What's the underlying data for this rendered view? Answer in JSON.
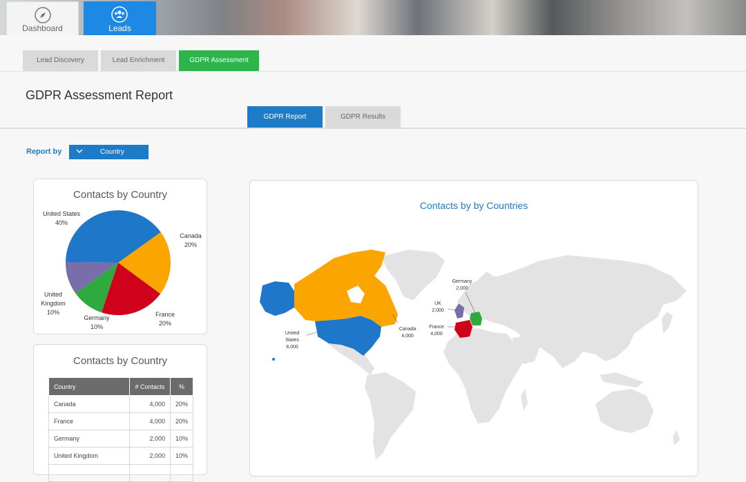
{
  "app_tabs": {
    "dashboard": "Dashboard",
    "leads": "Leads"
  },
  "sub_tabs": [
    "Lead Discovery",
    "Lead Enrichment",
    "GDPR Assessment"
  ],
  "page_title": "GDPR Assessment Report",
  "view_tabs": [
    "GDPR Report",
    "GDPR Results"
  ],
  "report_by": {
    "label": "Report by",
    "value": "Country"
  },
  "colors": {
    "us": "#1f77c9",
    "canada": "#fba500",
    "france": "#d0021b",
    "germany": "#2eaa3f",
    "uk": "#7a6eaa",
    "accent": "#1e7bc8",
    "active_tab": "#2bb54a"
  },
  "pie_card": {
    "title": "Contacts by Country"
  },
  "table_card": {
    "title": "Contacts by Country",
    "headers": [
      "Country",
      "# Contacts",
      "%"
    ],
    "rows": [
      [
        "Canada",
        "4,000",
        "20%"
      ],
      [
        "France",
        "4,000",
        "20%"
      ],
      [
        "Germany",
        "2,000",
        "10%"
      ],
      [
        "United Kingdom",
        "2,000",
        "10%"
      ]
    ]
  },
  "map_card": {
    "title": "Contacts by by Countries",
    "labels": {
      "us": [
        "United",
        "States",
        "8,000"
      ],
      "canada": [
        "Canada",
        "4,000"
      ],
      "germany": [
        "Germany",
        "2,000"
      ],
      "uk": [
        "UK",
        "2,000"
      ],
      "france": [
        "France",
        "4,000"
      ]
    }
  },
  "chart_data": {
    "type": "pie",
    "title": "Contacts by Country",
    "categories": [
      "United States",
      "Canada",
      "France",
      "Germany",
      "United Kingdom"
    ],
    "values": [
      40,
      20,
      20,
      10,
      10
    ],
    "labels": [
      "40%",
      "20%",
      "20%",
      "10%",
      "10%"
    ],
    "colors": [
      "#1f77c9",
      "#fba500",
      "#d0021b",
      "#2eaa3f",
      "#7a6eaa"
    ]
  }
}
